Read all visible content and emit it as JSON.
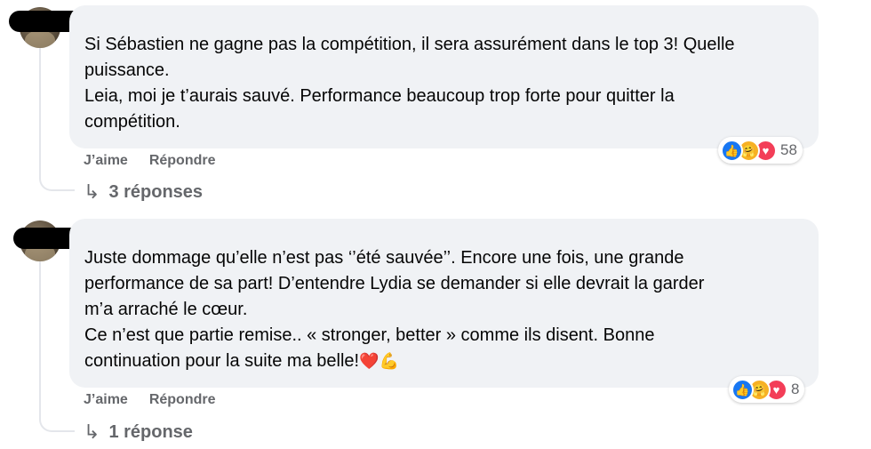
{
  "comments": [
    {
      "text": "Si Sébastien ne gagne pas la compétition, il sera assurément dans le top 3! Quelle\npuissance.\nLeia, moi je t’aurais sauvé. Performance beaucoup trop forte pour quitter la\ncompétition.",
      "emoji_suffix": "",
      "reactions": {
        "icons": [
          "like-icon",
          "care-icon",
          "love-icon"
        ],
        "count": "58"
      },
      "actions": {
        "like": "J’aime",
        "reply": "Répondre"
      },
      "replies_label": "3 réponses"
    },
    {
      "text": "Juste dommage qu’elle n’est pas ‘’été sauvée’’. Encore une fois, une grande\nperformance de sa part! D’entendre Lydia se demander si elle devrait la garder\nm’a arraché le cœur.\nCe n’est que partie remise.. « stronger, better » comme ils disent. Bonne\ncontinuation pour la suite ma belle!",
      "emoji_suffix": "❤️💪",
      "reactions": {
        "icons": [
          "like-icon",
          "care-icon",
          "love-icon"
        ],
        "count": "8"
      },
      "actions": {
        "like": "J’aime",
        "reply": "Répondre"
      },
      "replies_label": "1 réponse"
    }
  ],
  "colors": {
    "bubble": "#f0f2f5",
    "secondary_text": "#65676b",
    "like": "#1877f2",
    "love": "#f33e58",
    "care": "#f7b125"
  }
}
